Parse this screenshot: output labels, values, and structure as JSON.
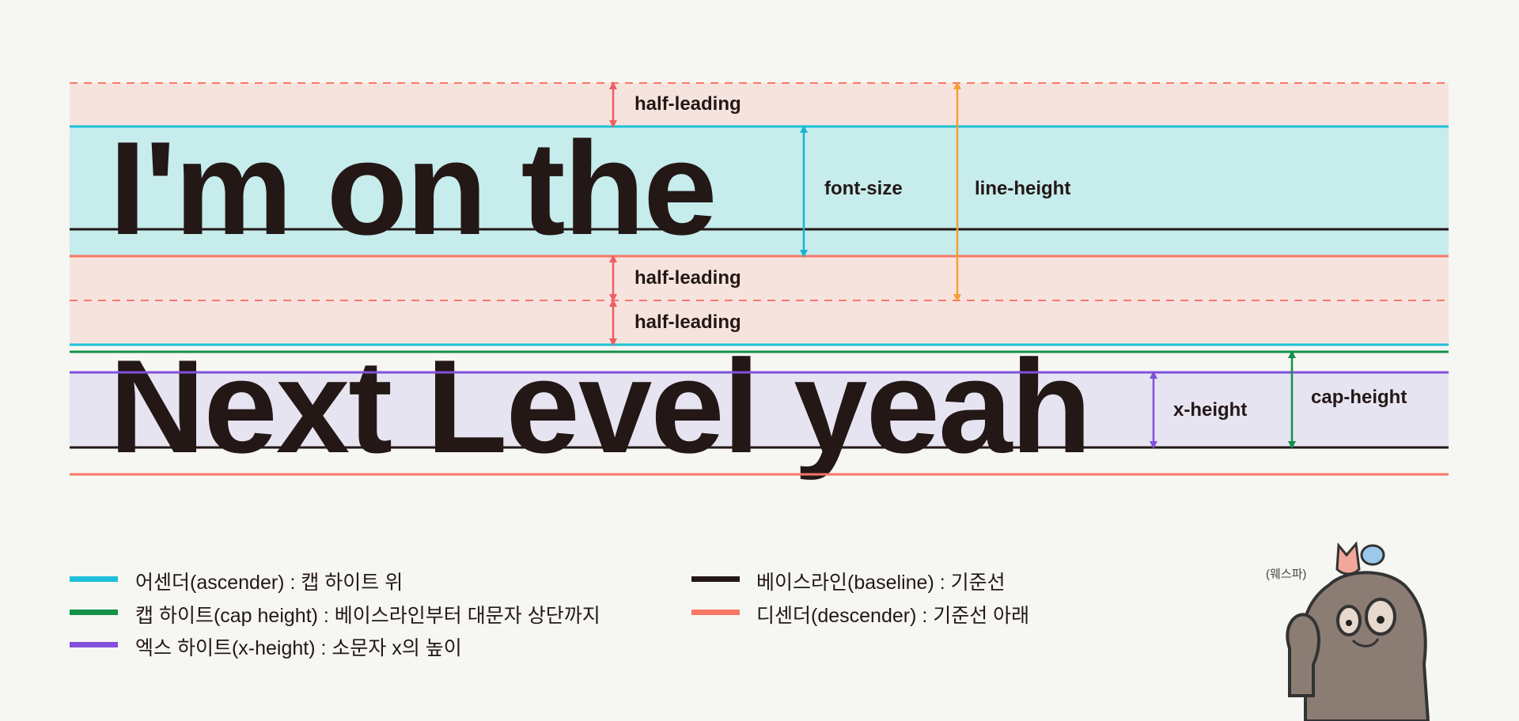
{
  "diagram": {
    "line1_text": "I'm on the",
    "line2_text": "Next Level yeah",
    "annotations": {
      "half_leading_top": "half-leading",
      "half_leading_mid": "half-leading",
      "half_leading_next": "half-leading",
      "font_size": "font-size",
      "line_height": "line-height",
      "x_height": "x-height",
      "cap_height": "cap-height"
    }
  },
  "legend": {
    "items": [
      {
        "label": "어센더(ascender) : 캡 하이트 위",
        "color": "#1cc0d8"
      },
      {
        "label": "캡 하이트(cap height) : 베이스라인부터 대문자 상단까지",
        "color": "#13914b"
      },
      {
        "label": "엑스 하이트(x-height) : 소문자 x의 높이",
        "color": "#8150dc"
      },
      {
        "label": "베이스라인(baseline) : 기준선",
        "color": "#231816"
      },
      {
        "label": "디센더(descender) : 기준선 아래",
        "color": "#f87868"
      }
    ]
  },
  "mascot": {
    "caption": "(웨스파)"
  },
  "colors": {
    "background": "#f6f6f2",
    "leading_band": "#f7e3de",
    "font_band": "#c6ecec",
    "xheight_band": "#e7e4f2",
    "half_leading_arrow": "#ec5f66",
    "font_size_arrow": "#1cb4d0",
    "line_height_arrow": "#f5a033"
  }
}
